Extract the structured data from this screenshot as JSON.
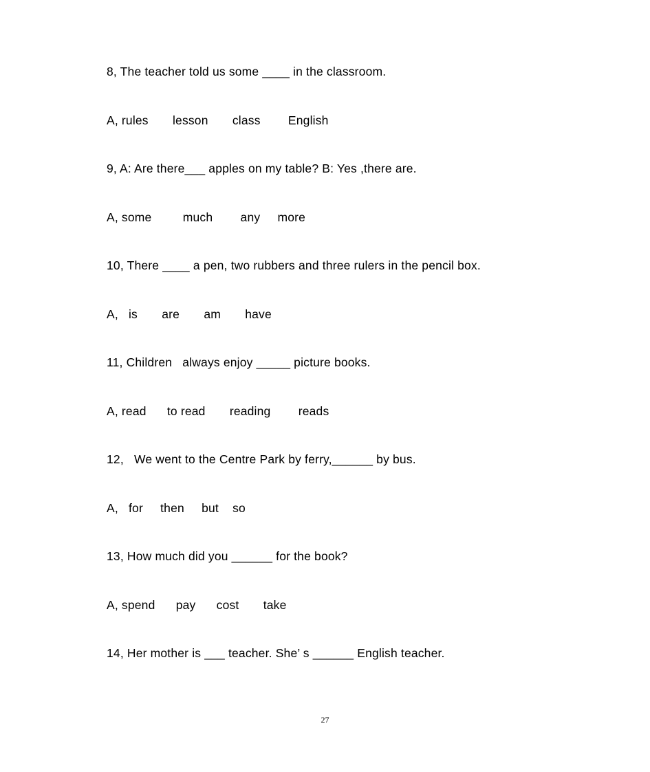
{
  "document": {
    "page_number": "27",
    "background_color": "#ffffff",
    "text_color": "#000000"
  },
  "questions": [
    {
      "number": "8,",
      "prompt": "8, The teacher told us some ____ in the classroom.",
      "options_line": "A, rules       lesson       class        English",
      "options": [
        "rules",
        "lesson",
        "class",
        "English"
      ]
    },
    {
      "number": "9,",
      "prompt": "9, A: Are there___ apples on my table? B: Yes ,there are.",
      "options_line": "A, some         much        any     more",
      "options": [
        "some",
        "much",
        "any",
        "more"
      ]
    },
    {
      "number": "10,",
      "prompt": "10, There ____ a pen, two rubbers and three rulers in the pencil box.",
      "options_line": "A,   is       are       am       have",
      "options": [
        "is",
        "are",
        "am",
        "have"
      ]
    },
    {
      "number": "11,",
      "prompt": "11, Children   always enjoy _____ picture books.",
      "options_line": "A, read      to read       reading        reads",
      "options": [
        "read",
        "to read",
        "reading",
        "reads"
      ]
    },
    {
      "number": "12,",
      "prompt": "12,   We went to the Centre Park by ferry,______ by bus.",
      "options_line": "A,   for     then     but    so",
      "options": [
        "for",
        "then",
        "but",
        "so"
      ]
    },
    {
      "number": "13,",
      "prompt": "13, How much did you ______ for the book?",
      "options_line": "A, spend      pay      cost       take",
      "options": [
        "spend",
        "pay",
        "cost",
        "take"
      ]
    },
    {
      "number": "14,",
      "prompt": "14, Her mother is ___ teacher. She’ s ______ English teacher.",
      "options_line": "",
      "options": []
    }
  ]
}
